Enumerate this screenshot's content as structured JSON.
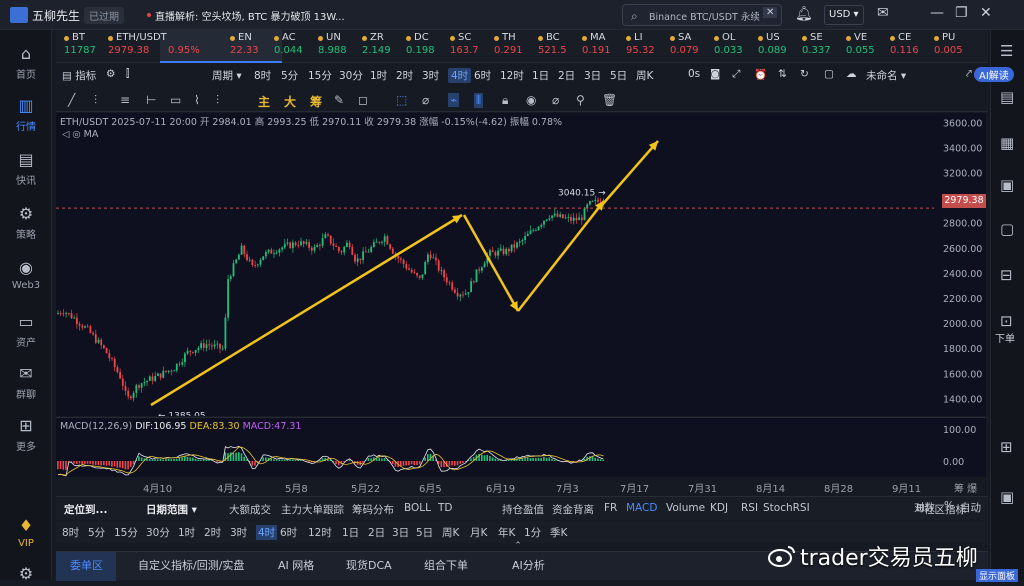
{
  "app": {
    "name": "五柳先生",
    "auth_badge": "已过期",
    "news_prefix": "直播解析:",
    "news": "空头坟场, BTC 暴力破顶 13W...",
    "search_placeholder": "Binance BTC/USDT 永续",
    "currency": "USD"
  },
  "leftnav": [
    {
      "label": "首页",
      "icon": "home-icon"
    },
    {
      "label": "行情",
      "icon": "chart-icon",
      "active": true
    },
    {
      "label": "快讯",
      "icon": "news-icon"
    },
    {
      "label": "策略",
      "icon": "robot-icon"
    },
    {
      "label": "Web3",
      "icon": "web3-icon"
    },
    {
      "label": "资产",
      "icon": "wallet-icon"
    },
    {
      "label": "群聊",
      "icon": "chat-icon"
    },
    {
      "label": "更多",
      "icon": "grid-icon"
    },
    {
      "label": "VIP",
      "icon": "diamond-icon"
    }
  ],
  "rightnav": {
    "down_label": "下单"
  },
  "ticker": [
    {
      "sym": "BT",
      "price": "11787",
      "dir": "up"
    },
    {
      "sym": "ETH/USDT",
      "price": "2979.38",
      "chg": "0.95%",
      "dir": "dn",
      "active": true
    },
    {
      "sym": "EN",
      "price": "22.33",
      "dir": "dn"
    },
    {
      "sym": "AC",
      "price": "0.044",
      "dir": "up"
    },
    {
      "sym": "UN",
      "price": "8.988",
      "dir": "up"
    },
    {
      "sym": "ZR",
      "price": "2.149",
      "dir": "up"
    },
    {
      "sym": "DC",
      "price": "0.198",
      "dir": "up"
    },
    {
      "sym": "SC",
      "price": "163.7",
      "dir": "dn"
    },
    {
      "sym": "TH",
      "price": "0.291",
      "dir": "dn"
    },
    {
      "sym": "BC",
      "price": "521.5",
      "dir": "dn"
    },
    {
      "sym": "MA",
      "price": "0.191",
      "dir": "dn"
    },
    {
      "sym": "LI",
      "price": "95.32",
      "dir": "dn"
    },
    {
      "sym": "SA",
      "price": "0.079",
      "dir": "dn"
    },
    {
      "sym": "OL",
      "price": "0.033",
      "dir": "up"
    },
    {
      "sym": "US",
      "price": "0.089",
      "dir": "up"
    },
    {
      "sym": "SE",
      "price": "0.337",
      "dir": "up"
    },
    {
      "sym": "VE",
      "price": "0.055",
      "dir": "up"
    },
    {
      "sym": "CE",
      "price": "0.116",
      "dir": "dn"
    },
    {
      "sym": "PU",
      "price": "0.005",
      "dir": "dn"
    }
  ],
  "toolbar1": {
    "indicator": "指标",
    "period": "周期",
    "intervals": [
      "8时",
      "5分",
      "15分",
      "30分",
      "1时",
      "2时",
      "3时",
      "4时",
      "6时",
      "12时",
      "1日",
      "2日",
      "3日",
      "5日",
      "周K"
    ],
    "selected": "4时",
    "countdown": "0s",
    "layout_name": "未命名",
    "ai": "AI解读"
  },
  "toolbar2": {
    "main": "主",
    "big": "大",
    "chips": "筹"
  },
  "chart": {
    "info": "ETH/USDT  2025-07-11 20:00  开 2984.01  高 2993.25  低 2970.11  收 2979.38  涨幅 -0.15%(-4.62)  振幅 0.78%",
    "ma": "MA",
    "high_label": "3040.15",
    "low_label": "1385.05",
    "price_tag": "2979.38"
  },
  "macd": {
    "label": "MACD(12,26,9)",
    "dif": "DIF:106.95",
    "dea": "DEA:83.30",
    "macd": "MACD:47.31"
  },
  "chart_data": {
    "type": "candlestick",
    "title": "ETH/USDT",
    "interval": "4时",
    "ylim": [
      1300,
      3650
    ],
    "yticks": [
      3600,
      3400,
      3200,
      3000,
      2800,
      2600,
      2400,
      2200,
      2000,
      1800,
      1600,
      1400
    ],
    "xticks": [
      "4月10",
      "4月24",
      "5月8",
      "5月22",
      "6月5",
      "6月19",
      "7月3",
      "7月17",
      "7月31",
      "8月14",
      "8月28",
      "9月11"
    ],
    "macd_yticks": [
      "100.00",
      "0.00"
    ],
    "high": 3040.15,
    "low": 1385.05,
    "last": 2979.38
  },
  "bottom1": {
    "locate": "定位到...",
    "date_range": "日期范围",
    "items": [
      "大额成交",
      "主力大单跟踪",
      "筹码分布",
      "BOLL",
      "TD"
    ],
    "right": [
      "持仓盈值",
      "资金背离",
      "FR",
      "MACD",
      "Volume",
      "KDJ",
      "RSI",
      "StochRSI"
    ],
    "community": "社区指标",
    "log": "对数",
    "pct": "%",
    "auto": "自动"
  },
  "bottom2": {
    "intervals": [
      "8时",
      "5分",
      "15分",
      "30分",
      "1时",
      "2时",
      "3时",
      "4时",
      "6时",
      "12时",
      "1日",
      "2日",
      "3日",
      "5日",
      "周K",
      "月K",
      "年K",
      "1分",
      "季K"
    ],
    "selected": "4时"
  },
  "bottom3": {
    "tabs": [
      "委单区",
      "自定义指标/回测/实盘",
      "AI 网格",
      "现货DCA",
      "组合下单",
      "AI分析"
    ],
    "show": "显示面板"
  },
  "watermark": "trader交易员五柳"
}
